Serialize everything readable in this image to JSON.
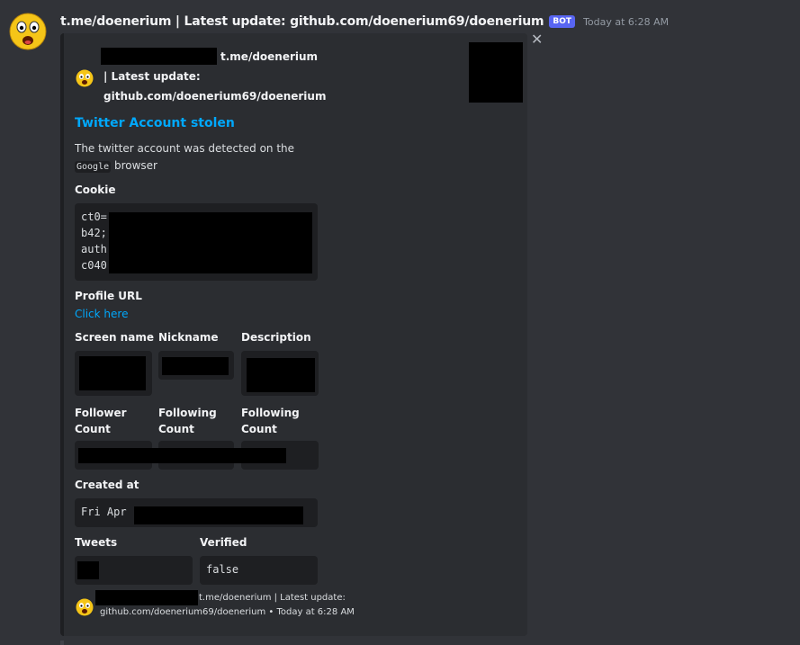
{
  "message": {
    "username": "t.me/doenerium | Latest update: github.com/doenerium69/doenerium",
    "bot_tag": "BOT",
    "timestamp": "Today at 6:28 AM",
    "avatar_icon": "shocked-face-emoji-icon",
    "dismiss_icon": "close-icon",
    "dismiss_glyph": "✕"
  },
  "embed": {
    "author_line1": "t.me/doenerium",
    "author_line2": "| Latest update:",
    "author_line3": "github.com/doenerium69/doenerium",
    "title": "Twitter Account stolen",
    "description_prefix": "The twitter account was detected on the",
    "description_code": "Google",
    "description_suffix": "browser",
    "fields": {
      "cookie": {
        "name": "Cookie",
        "lines": [
          "ct0=",
          "b42;",
          "auth",
          "c040"
        ]
      },
      "profile_url": {
        "name": "Profile URL",
        "link": "Click here"
      },
      "screen_name": {
        "name": "Screen name"
      },
      "nickname": {
        "name": "Nickname"
      },
      "description": {
        "name": "Description"
      },
      "follower_count": {
        "name_line1": "Follower",
        "name_line2": "Count"
      },
      "following_count_1": {
        "name_line1": "Following",
        "name_line2": "Count"
      },
      "following_count_2": {
        "name_line1": "Following",
        "name_line2": "Count"
      },
      "created_at": {
        "name": "Created at",
        "value": "Fri Apr"
      },
      "tweets": {
        "name": "Tweets"
      },
      "verified": {
        "name": "Verified",
        "value": "false"
      }
    },
    "footer": {
      "line1": "t.me/doenerium | Latest update:",
      "line2": "github.com/doenerium69/doenerium • Today at 6:28 AM"
    },
    "colors": {
      "background": "#313338",
      "embed_background": "#2b2d31",
      "code_background": "#1e1f22",
      "link": "#00a8fc",
      "bot_tag": "#5865f2"
    }
  }
}
